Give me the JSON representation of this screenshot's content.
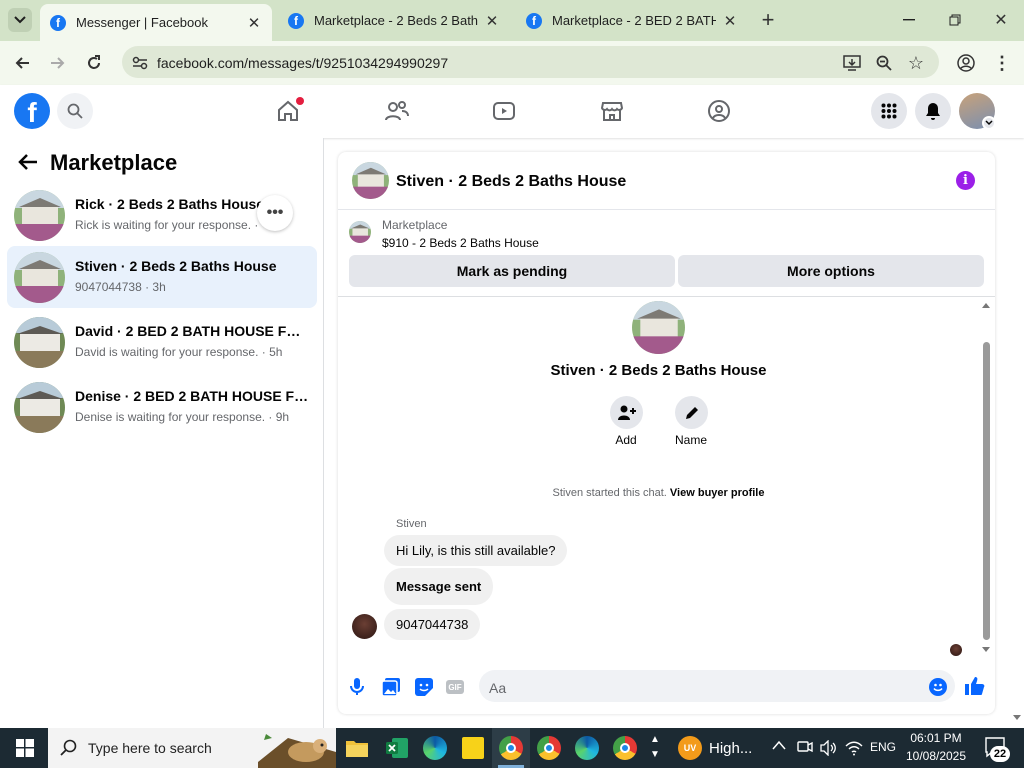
{
  "browser": {
    "tabs": [
      {
        "title": "Messenger | Facebook",
        "active": true
      },
      {
        "title": "Marketplace - 2 Beds 2 Baths H"
      },
      {
        "title": "Marketplace - 2 BED 2 BATH HO"
      }
    ],
    "url": "facebook.com/messages/t/9251034294990297"
  },
  "colors": {
    "fb_blue": "#1877f2",
    "purple_accent": "#9b1fe8",
    "selected_bg": "#e8f1fc"
  },
  "sidebar": {
    "title": "Marketplace",
    "conversations": [
      {
        "name": "Rick · 2 Beds 2 Baths House",
        "preview": "Rick is waiting for your response. · 3h",
        "preview_short": "Rick is waiting for your response. · 3h"
      },
      {
        "name": "Stiven · 2 Beds 2 Baths House",
        "preview": "9047044738 · 3h"
      },
      {
        "name": "David · 2 BED 2 BATH HOUSE FOR ...",
        "preview": "David is waiting for your response. · 5h"
      },
      {
        "name": "Denise · 2 BED 2 BATH HOUSE FO...",
        "preview": "Denise is waiting for your response. · 9h"
      }
    ]
  },
  "chat": {
    "header_name": "Stiven · 2 Beds 2 Baths House",
    "listing_label": "Marketplace",
    "listing_title": "$910 - 2 Beds 2 Baths House",
    "mark_pending": "Mark as pending",
    "more_options": "More options",
    "profile_name": "Stiven · 2 Beds 2 Baths House",
    "add_label": "Add",
    "name_label": "Name",
    "started_text": "Stiven started this chat.",
    "view_buyer_profile": "View buyer profile",
    "sender_label": "Stiven",
    "messages": [
      {
        "text": "Hi Lily, is this still available?"
      },
      {
        "text": "Message sent"
      },
      {
        "text": "9047044738"
      }
    ],
    "composer_placeholder": "Aa"
  },
  "taskbar": {
    "search_placeholder": "Type here to search",
    "weather_text": "High...",
    "language": "ENG",
    "time": "06:01 PM",
    "date": "10/08/2025",
    "notification_count": "22"
  }
}
